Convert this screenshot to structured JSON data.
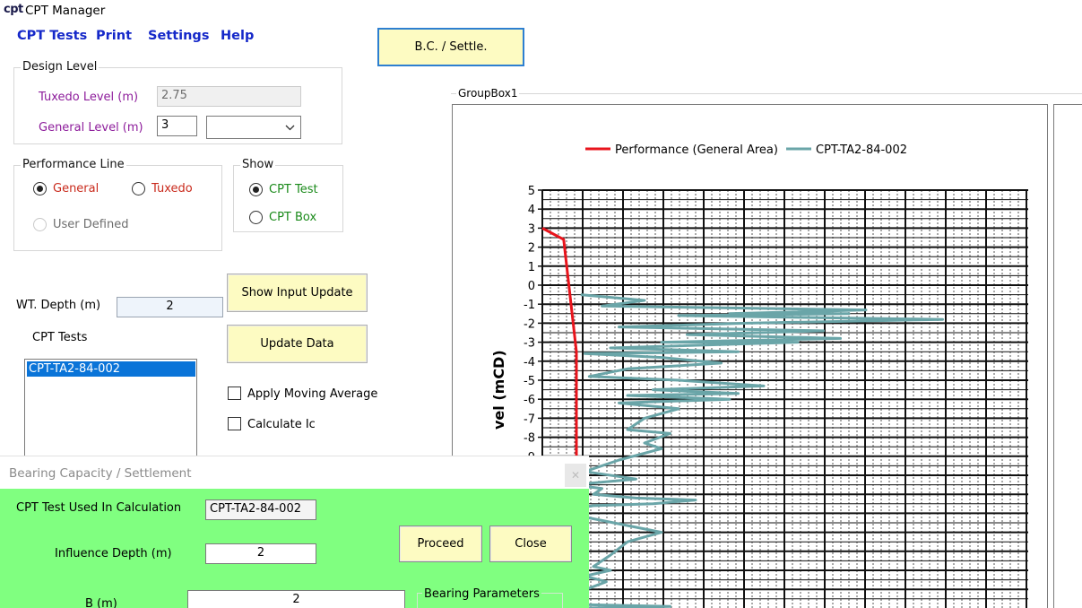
{
  "app": {
    "logo": "cpt",
    "title": "CPT Manager"
  },
  "menu": [
    "CPT Tests",
    "Print",
    "Settings",
    "Help"
  ],
  "bc_button": "B.C. / Settle.",
  "design_level": {
    "title": "Design Level",
    "tuxedo_label": "Tuxedo Level (m)",
    "tuxedo_value": "2.75",
    "general_label": "General Level (m)",
    "general_value": "3",
    "combo_value": ""
  },
  "performance_line": {
    "title": "Performance Line",
    "general": "General",
    "tuxedo": "Tuxedo",
    "user_defined": "User Defined",
    "selected": "general"
  },
  "show": {
    "title": "Show",
    "cpt_test": "CPT Test",
    "cpt_box": "CPT Box",
    "selected": "cpt_test"
  },
  "wt_depth": {
    "label": "WT. Depth (m)",
    "value": "2"
  },
  "buttons": {
    "show_input_update": "Show Input Update",
    "update_data": "Update Data"
  },
  "cpt_tests": {
    "label": "CPT Tests",
    "items": [
      "CPT-TA2-84-002"
    ],
    "selected": 0
  },
  "options": {
    "moving_average": "Apply Moving Average",
    "calculate_ic": "Calculate Ic"
  },
  "chart_group_title": "GroupBox1",
  "chart_data": {
    "type": "line",
    "ylabel": "vel (mCD)",
    "y_ticks": [
      5,
      4,
      3,
      2,
      1,
      0,
      -1,
      -2,
      -3,
      -4,
      -5,
      -6,
      -7,
      -8,
      -9
    ],
    "ylim_visible": [
      -9,
      5
    ],
    "colors": {
      "performance": "#e8141c",
      "cpt": "#6aa5a8"
    },
    "series": [
      {
        "name": "Performance (General Area)",
        "points": [
          [
            0,
            3.0
          ],
          [
            0.25,
            2.4
          ],
          [
            0.4,
            -3.5
          ],
          [
            0.4,
            -17.0
          ]
        ]
      },
      {
        "name": "CPT-TA2-84-002",
        "points": [
          [
            0.45,
            -0.5
          ],
          [
            1.2,
            -0.8
          ],
          [
            0.7,
            -1.1
          ],
          [
            3.8,
            -1.3
          ],
          [
            2.2,
            -1.5
          ],
          [
            3.6,
            -1.5
          ],
          [
            1.6,
            -1.6
          ],
          [
            4.7,
            -1.8
          ],
          [
            2.4,
            -2.0
          ],
          [
            0.9,
            -2.2
          ],
          [
            3.3,
            -2.4
          ],
          [
            1.7,
            -2.6
          ],
          [
            3.5,
            -2.8
          ],
          [
            1.4,
            -3.0
          ],
          [
            3.0,
            -3.0
          ],
          [
            0.8,
            -3.3
          ],
          [
            2.3,
            -3.5
          ],
          [
            0.5,
            -3.6
          ],
          [
            1.4,
            -3.8
          ],
          [
            2.1,
            -4.1
          ],
          [
            1.0,
            -4.4
          ],
          [
            0.55,
            -4.8
          ],
          [
            1.6,
            -5.0
          ],
          [
            2.6,
            -5.3
          ],
          [
            1.3,
            -5.5
          ],
          [
            2.3,
            -5.7
          ],
          [
            1.0,
            -5.8
          ],
          [
            2.2,
            -6.0
          ],
          [
            0.9,
            -6.2
          ],
          [
            1.6,
            -6.5
          ],
          [
            1.2,
            -7.0
          ],
          [
            1.0,
            -7.6
          ],
          [
            1.5,
            -7.8
          ],
          [
            1.2,
            -8.3
          ],
          [
            1.4,
            -8.6
          ],
          [
            0.9,
            -9.2
          ],
          [
            0.5,
            -9.8
          ],
          [
            1.1,
            -10.2
          ],
          [
            0.35,
            -10.5
          ],
          [
            0.7,
            -10.7
          ],
          [
            0.6,
            -11.0
          ],
          [
            1.1,
            -11.2
          ],
          [
            1.8,
            -11.3
          ],
          [
            1.3,
            -11.5
          ],
          [
            0.6,
            -11.6
          ],
          [
            0.3,
            -11.8
          ],
          [
            0.5,
            -12.2
          ],
          [
            1.4,
            -13.0
          ],
          [
            1.0,
            -13.5
          ],
          [
            0.8,
            -14.2
          ],
          [
            0.6,
            -14.8
          ],
          [
            0.8,
            -15.0
          ],
          [
            0.5,
            -15.3
          ],
          [
            0.75,
            -15.6
          ],
          [
            0.4,
            -16.2
          ],
          [
            0.5,
            -16.8
          ],
          [
            1.5,
            -16.9
          ],
          [
            0.3,
            -17.0
          ]
        ]
      }
    ]
  },
  "dialog": {
    "title": "Bearing Capacity / Settlement",
    "close_glyph": "✕",
    "cpt_label": "CPT Test Used In Calculation",
    "cpt_value": "CPT-TA2-84-002",
    "influence_label": "Influence Depth (m)",
    "influence_value": "2",
    "b_label": "B (m)",
    "b_value": "2",
    "proceed": "Proceed",
    "close": "Close",
    "bearing_params": "Bearing Parameters"
  }
}
